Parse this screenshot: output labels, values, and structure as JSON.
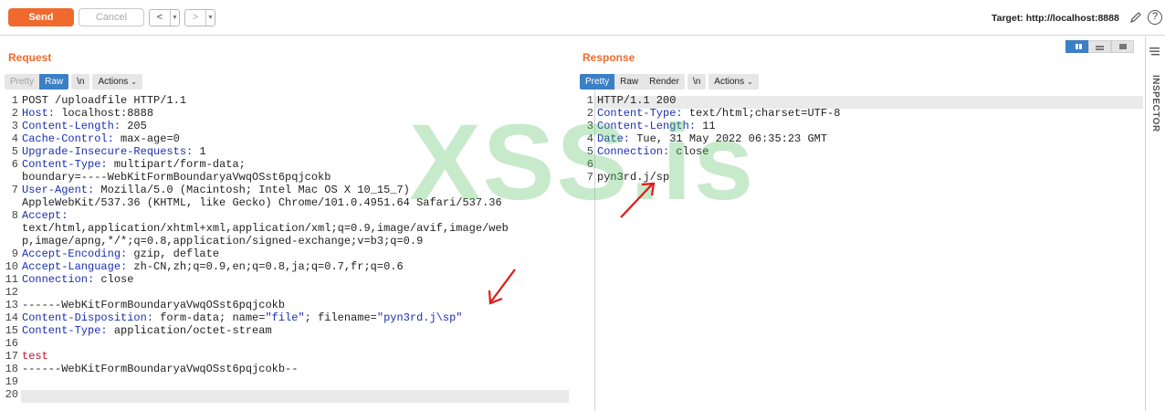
{
  "toolbar": {
    "send_label": "Send",
    "cancel_label": "Cancel",
    "back_label": "<",
    "forward_label": ">",
    "target_label": "Target: http://localhost:8888"
  },
  "request": {
    "title": "Request",
    "tabs": {
      "pretty": "Pretty",
      "raw": "Raw",
      "newline": "\\n",
      "actions": "Actions"
    },
    "line_numbers": [
      "1",
      "2",
      "3",
      "4",
      "5",
      "6",
      "",
      "7",
      "",
      "8",
      "",
      "",
      "9",
      "10",
      "11",
      "12",
      "13",
      "14",
      "15",
      "16",
      "17",
      "18",
      "19",
      "20"
    ],
    "lines": [
      {
        "value": "POST /uploadfile HTTP/1.1"
      },
      {
        "key": "Host:",
        "value": " localhost:8888"
      },
      {
        "key": "Content-Length:",
        "value": " 205"
      },
      {
        "key": "Cache-Control:",
        "value": " max-age=0"
      },
      {
        "key": "Upgrade-Insecure-Requests:",
        "value": " 1"
      },
      {
        "key": "Content-Type:",
        "value": " multipart/form-data;"
      },
      {
        "value": "boundary=----WebKitFormBoundaryaVwqOSst6pqjcokb"
      },
      {
        "key": "User-Agent:",
        "value": " Mozilla/5.0 (Macintosh; Intel Mac OS X 10_15_7)"
      },
      {
        "value": "AppleWebKit/537.36 (KHTML, like Gecko) Chrome/101.0.4951.64 Safari/537.36"
      },
      {
        "key": "Accept:",
        "value": ""
      },
      {
        "value": "text/html,application/xhtml+xml,application/xml;q=0.9,image/avif,image/web"
      },
      {
        "value": "p,image/apng,*/*;q=0.8,application/signed-exchange;v=b3;q=0.9"
      },
      {
        "key": "Accept-Encoding:",
        "value": " gzip, deflate"
      },
      {
        "key": "Accept-Language:",
        "value": " zh-CN,zh;q=0.9,en;q=0.8,ja;q=0.7,fr;q=0.6"
      },
      {
        "key": "Connection:",
        "value": " close"
      },
      {
        "value": ""
      },
      {
        "value": "------WebKitFormBoundaryaVwqOSst6pqjcokb"
      },
      {
        "key": "Content-Disposition:",
        "value": " form-data; name=",
        "s1": "\"file\"",
        "mid": "; filename=",
        "s2": "\"pyn3rd.j\\sp\""
      },
      {
        "key": "Content-Type:",
        "value": " application/octet-stream"
      },
      {
        "value": ""
      },
      {
        "red": "test"
      },
      {
        "value": "------WebKitFormBoundaryaVwqOSst6pqjcokb--"
      },
      {
        "value": ""
      },
      {
        "value": ""
      }
    ]
  },
  "response": {
    "title": "Response",
    "tabs": {
      "pretty": "Pretty",
      "raw": "Raw",
      "render": "Render",
      "newline": "\\n",
      "actions": "Actions"
    },
    "line_numbers": [
      "1",
      "2",
      "3",
      "4",
      "5",
      "6",
      "7"
    ],
    "lines": [
      {
        "value": "HTTP/1.1 200"
      },
      {
        "key": "Content-Type:",
        "value": " text/html;charset=UTF-8"
      },
      {
        "key": "Content-Length:",
        "value": " 11"
      },
      {
        "key": "Date:",
        "value": " Tue, 31 May 2022 06:35:23 GMT"
      },
      {
        "key": "Connection:",
        "value": " close"
      },
      {
        "value": ""
      },
      {
        "value": "pyn3rd.j/sp"
      }
    ]
  },
  "inspector": {
    "label": "INSPECTOR"
  },
  "watermark": {
    "text": "XSS.is"
  },
  "colors": {
    "accent": "#ef6a2c",
    "active_tab": "#3b7fc4",
    "header_key": "#1a2fb0",
    "annotation_arrow": "#e01818"
  }
}
